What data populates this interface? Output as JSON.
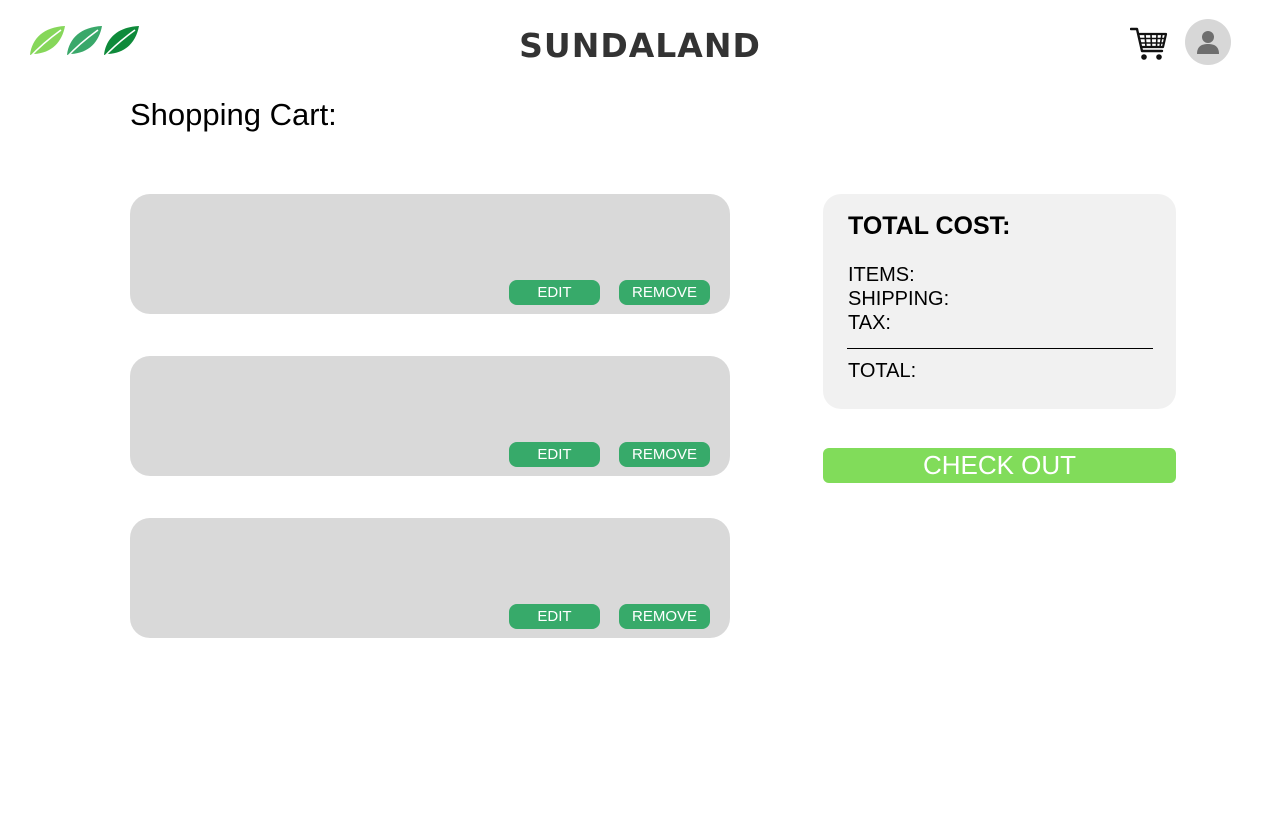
{
  "header": {
    "brand": "SUNDALAND",
    "logo_icon": "leaf-trio-logo",
    "cart_icon": "shopping-cart-icon",
    "avatar_icon": "user-icon",
    "colors": {
      "leaf_light": "#86d75a",
      "leaf_mid": "#3aa86a",
      "leaf_dark": "#0e8a3a"
    }
  },
  "page": {
    "title": "Shopping Cart:"
  },
  "cart": {
    "items": [
      {
        "edit_label": "EDIT",
        "remove_label": "REMOVE"
      },
      {
        "edit_label": "EDIT",
        "remove_label": "REMOVE"
      },
      {
        "edit_label": "EDIT",
        "remove_label": "REMOVE"
      }
    ]
  },
  "summary": {
    "title": "TOTAL COST:",
    "items_label": "ITEMS:",
    "shipping_label": "SHIPPING:",
    "tax_label": "TAX:",
    "total_label": "TOTAL:"
  },
  "checkout": {
    "label": "CHECK OUT"
  },
  "theme": {
    "button_green": "#37aa6a",
    "checkout_green": "#81dc5a",
    "card_gray": "#d9d9d9",
    "panel_gray": "#f1f1f1"
  }
}
